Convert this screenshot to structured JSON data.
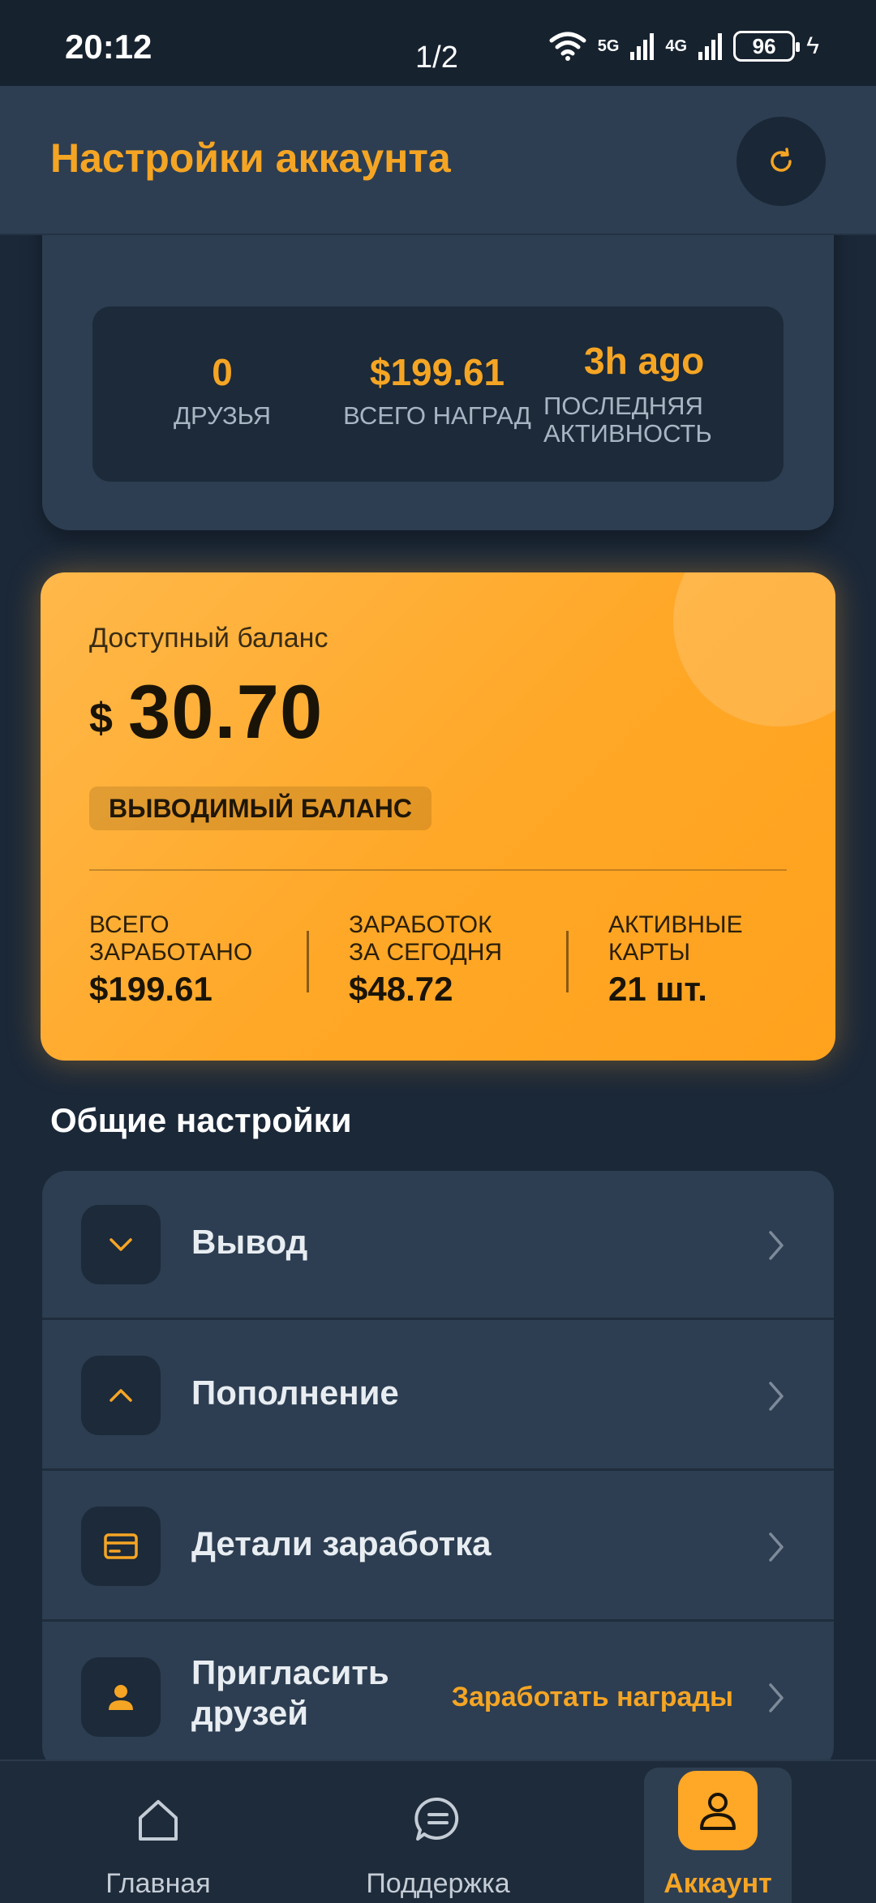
{
  "status_bar": {
    "time": "20:12",
    "page_indicator": "1/2",
    "net1": "5G",
    "net2": "4G",
    "battery": "96"
  },
  "header": {
    "title": "Настройки аккаунта",
    "refresh_icon": "refresh-icon"
  },
  "profile_stats": [
    {
      "value": "0",
      "label": "ДРУЗЬЯ"
    },
    {
      "value": "$199.61",
      "label": "ВСЕГО НАГРАД"
    },
    {
      "value": "3h ago",
      "label": "ПОСЛЕДНЯЯ АКТИВНОСТЬ"
    }
  ],
  "balance": {
    "label": "Доступный баланс",
    "currency": "$",
    "amount": "30.70",
    "badge": "ВЫВОДИМЫЙ БАЛАНС",
    "stats": [
      {
        "label": "ВСЕГО ЗАРАБОТАНО",
        "value": "$199.61"
      },
      {
        "label": "ЗАРАБОТОК ЗА СЕГОДНЯ",
        "value": "$48.72"
      },
      {
        "label": "АКТИВНЫЕ КАРТЫ",
        "value": "21 шт."
      }
    ]
  },
  "general_settings": {
    "title": "Общие настройки",
    "items": [
      {
        "label": "Вывод",
        "icon": "chevron-down-icon"
      },
      {
        "label": "Пополнение",
        "icon": "chevron-up-icon"
      },
      {
        "label": "Детали заработка",
        "icon": "card-icon"
      },
      {
        "label": "Пригласить друзей",
        "icon": "user-icon",
        "extra": "Заработать награды"
      }
    ]
  },
  "bottom_nav": [
    {
      "label": "Главная",
      "icon": "home-icon"
    },
    {
      "label": "Поддержка",
      "icon": "chat-icon"
    },
    {
      "label": "Аккаунт",
      "icon": "user-icon",
      "active": true
    }
  ],
  "colors": {
    "accent": "#f5a524",
    "background": "#1b2838",
    "card": "#2d3e52"
  }
}
